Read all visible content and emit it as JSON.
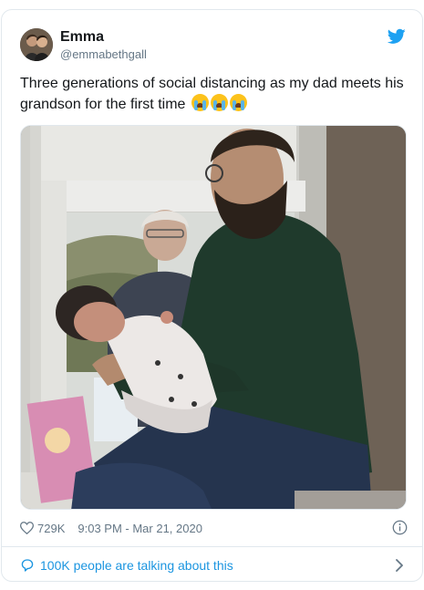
{
  "tweet": {
    "author_name": "Emma",
    "author_handle": "@emmabethgall",
    "text": "Three generations of social distancing as my dad meets his grandson for the first time",
    "emoji_name": "loudly-crying-face",
    "emoji_count": 3,
    "likes": "729K",
    "timestamp": "9:03 PM - Mar 21, 2020",
    "talking": "100K people are talking about this"
  },
  "icons": {
    "platform": "twitter-bird-icon",
    "like": "heart-icon",
    "info": "info-icon",
    "reply": "speech-bubble-icon",
    "more": "chevron-right-icon"
  },
  "colors": {
    "accent": "#1da1f2",
    "link": "#1b95e0",
    "muted": "#657786",
    "border": "#e1e8ed"
  }
}
